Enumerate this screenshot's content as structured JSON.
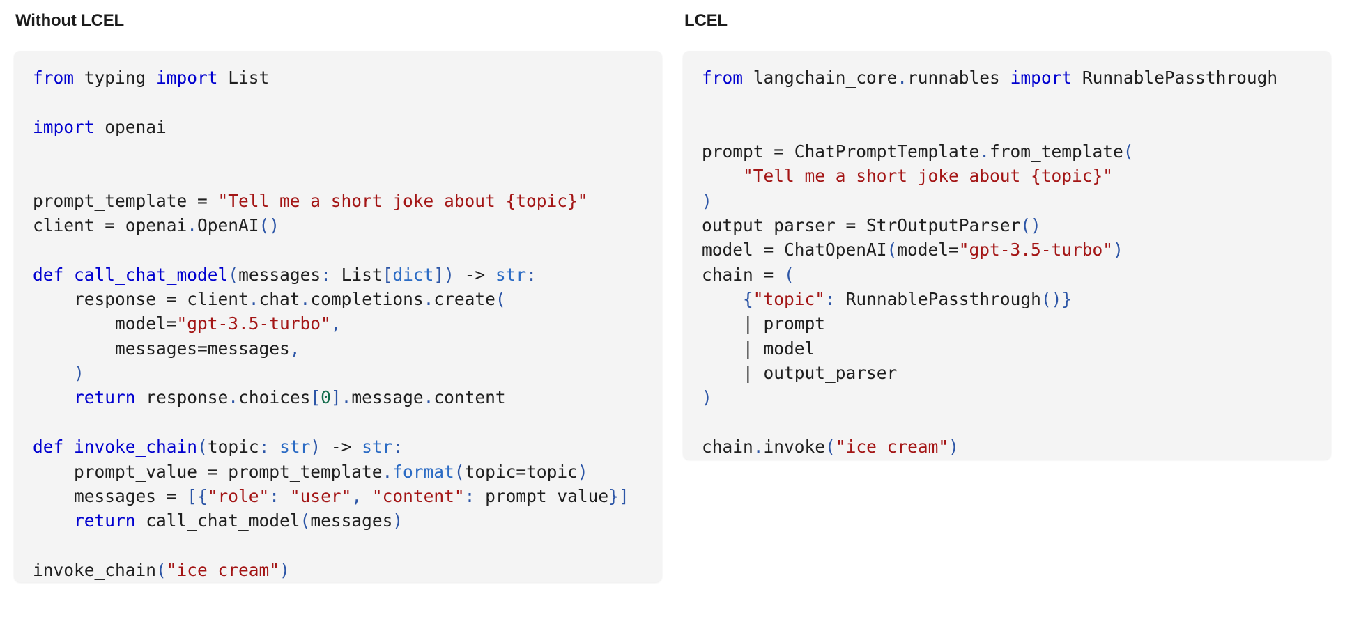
{
  "left_panel": {
    "title": "Without LCEL",
    "lines": [
      [
        [
          "from",
          "kw"
        ],
        [
          " typing ",
          "tx"
        ],
        [
          "import",
          "kw"
        ],
        [
          " List",
          "tx"
        ]
      ],
      [],
      [
        [
          "import",
          "kw"
        ],
        [
          " openai",
          "tx"
        ]
      ],
      [],
      [],
      [
        [
          "prompt_template = ",
          "tx"
        ],
        [
          "\"Tell me a short joke about {topic}\"",
          "str"
        ]
      ],
      [
        [
          "client = openai",
          "tx"
        ],
        [
          ".",
          "pn"
        ],
        [
          "OpenAI",
          "tx"
        ],
        [
          "()",
          "pn"
        ]
      ],
      [],
      [
        [
          "def",
          "kw"
        ],
        [
          " ",
          "tx"
        ],
        [
          "call_chat_model",
          "fn"
        ],
        [
          "(",
          "pn"
        ],
        [
          "messages",
          "tx"
        ],
        [
          ":",
          "pn"
        ],
        [
          " List",
          "tx"
        ],
        [
          "[",
          "pn"
        ],
        [
          "dict",
          "bi"
        ],
        [
          "])",
          "pn"
        ],
        [
          " -> ",
          "tx"
        ],
        [
          "str",
          "bi"
        ],
        [
          ":",
          "pn"
        ]
      ],
      [
        [
          "    response = client",
          "tx"
        ],
        [
          ".",
          "pn"
        ],
        [
          "chat",
          "tx"
        ],
        [
          ".",
          "pn"
        ],
        [
          "completions",
          "tx"
        ],
        [
          ".",
          "pn"
        ],
        [
          "create",
          "tx"
        ],
        [
          "(",
          "pn"
        ]
      ],
      [
        [
          "        model=",
          "tx"
        ],
        [
          "\"gpt-3.5-turbo\"",
          "str"
        ],
        [
          ",",
          "pn"
        ]
      ],
      [
        [
          "        messages=messages",
          "tx"
        ],
        [
          ",",
          "pn"
        ]
      ],
      [
        [
          "    ",
          "tx"
        ],
        [
          ")",
          "pn"
        ]
      ],
      [
        [
          "    ",
          "tx"
        ],
        [
          "return",
          "kw"
        ],
        [
          " response",
          "tx"
        ],
        [
          ".",
          "pn"
        ],
        [
          "choices",
          "tx"
        ],
        [
          "[",
          "pn"
        ],
        [
          "0",
          "num"
        ],
        [
          "]",
          "pn"
        ],
        [
          ".",
          "pn"
        ],
        [
          "message",
          "tx"
        ],
        [
          ".",
          "pn"
        ],
        [
          "content",
          "tx"
        ]
      ],
      [],
      [
        [
          "def",
          "kw"
        ],
        [
          " ",
          "tx"
        ],
        [
          "invoke_chain",
          "fn"
        ],
        [
          "(",
          "pn"
        ],
        [
          "topic",
          "tx"
        ],
        [
          ":",
          "pn"
        ],
        [
          " ",
          "tx"
        ],
        [
          "str",
          "bi"
        ],
        [
          ")",
          "pn"
        ],
        [
          " -> ",
          "tx"
        ],
        [
          "str",
          "bi"
        ],
        [
          ":",
          "pn"
        ]
      ],
      [
        [
          "    prompt_value = prompt_template",
          "tx"
        ],
        [
          ".",
          "pn"
        ],
        [
          "format",
          "bi"
        ],
        [
          "(",
          "pn"
        ],
        [
          "topic=topic",
          "tx"
        ],
        [
          ")",
          "pn"
        ]
      ],
      [
        [
          "    messages = ",
          "tx"
        ],
        [
          "[{",
          "pn"
        ],
        [
          "\"role\"",
          "str"
        ],
        [
          ":",
          "pn"
        ],
        [
          " ",
          "tx"
        ],
        [
          "\"user\"",
          "str"
        ],
        [
          ",",
          "pn"
        ],
        [
          " ",
          "tx"
        ],
        [
          "\"content\"",
          "str"
        ],
        [
          ":",
          "pn"
        ],
        [
          " prompt_value",
          "tx"
        ],
        [
          "}]",
          "pn"
        ]
      ],
      [
        [
          "    ",
          "tx"
        ],
        [
          "return",
          "kw"
        ],
        [
          " call_chat_model",
          "tx"
        ],
        [
          "(",
          "pn"
        ],
        [
          "messages",
          "tx"
        ],
        [
          ")",
          "pn"
        ]
      ],
      [],
      [
        [
          "invoke_chain",
          "tx"
        ],
        [
          "(",
          "pn"
        ],
        [
          "\"ice cream\"",
          "str"
        ],
        [
          ")",
          "pn"
        ]
      ]
    ]
  },
  "right_panel": {
    "title": "LCEL",
    "lines": [
      [
        [
          "from",
          "kw"
        ],
        [
          " langchain_core",
          "tx"
        ],
        [
          ".",
          "pn"
        ],
        [
          "runnables ",
          "tx"
        ],
        [
          "import",
          "kw"
        ],
        [
          " RunnablePassthrough",
          "tx"
        ]
      ],
      [],
      [],
      [
        [
          "prompt = ChatPromptTemplate",
          "tx"
        ],
        [
          ".",
          "pn"
        ],
        [
          "from_template",
          "tx"
        ],
        [
          "(",
          "pn"
        ]
      ],
      [
        [
          "    ",
          "tx"
        ],
        [
          "\"Tell me a short joke about {topic}\"",
          "str"
        ]
      ],
      [
        [
          ")",
          "pn"
        ]
      ],
      [
        [
          "output_parser = StrOutputParser",
          "tx"
        ],
        [
          "()",
          "pn"
        ]
      ],
      [
        [
          "model = ChatOpenAI",
          "tx"
        ],
        [
          "(",
          "pn"
        ],
        [
          "model=",
          "tx"
        ],
        [
          "\"gpt-3.5-turbo\"",
          "str"
        ],
        [
          ")",
          "pn"
        ]
      ],
      [
        [
          "chain = ",
          "tx"
        ],
        [
          "(",
          "pn"
        ]
      ],
      [
        [
          "    ",
          "tx"
        ],
        [
          "{",
          "pn"
        ],
        [
          "\"topic\"",
          "str"
        ],
        [
          ":",
          "pn"
        ],
        [
          " RunnablePassthrough",
          "tx"
        ],
        [
          "()}",
          "pn"
        ]
      ],
      [
        [
          "    | prompt",
          "tx"
        ]
      ],
      [
        [
          "    | model",
          "tx"
        ]
      ],
      [
        [
          "    | output_parser",
          "tx"
        ]
      ],
      [
        [
          ")",
          "pn"
        ]
      ],
      [],
      [
        [
          "chain",
          "tx"
        ],
        [
          ".",
          "pn"
        ],
        [
          "invoke",
          "tx"
        ],
        [
          "(",
          "pn"
        ],
        [
          "\"ice cream\"",
          "str"
        ],
        [
          ")",
          "pn"
        ]
      ]
    ]
  },
  "token_colors": {
    "kw": "#0000cf",
    "str": "#a31515",
    "pn": "#2c55a6",
    "bi": "#2b6bc4",
    "fn": "#0000cf",
    "num": "#136c4c",
    "tx": "#1f1f1f"
  }
}
